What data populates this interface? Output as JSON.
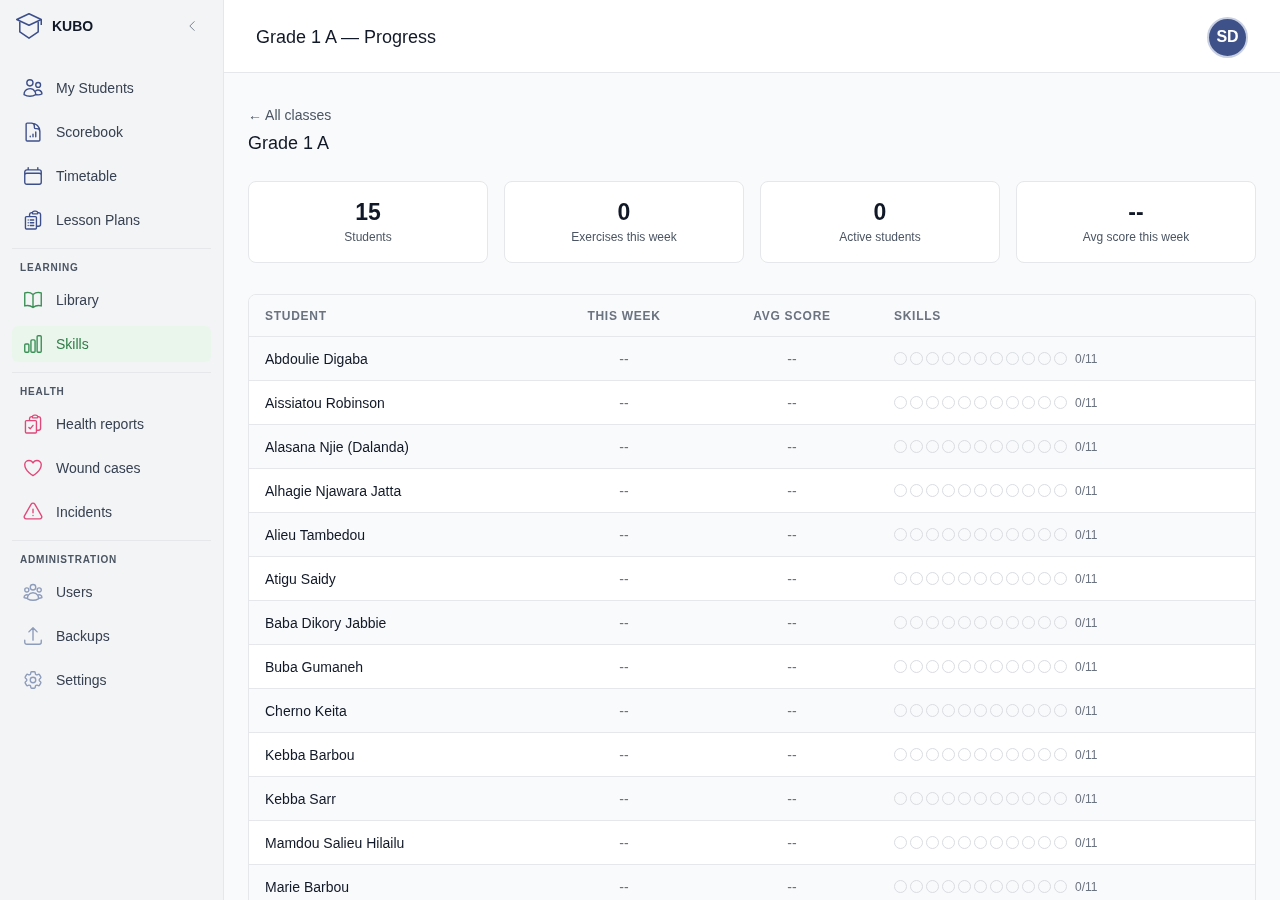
{
  "sidebar": {
    "brand": "KUBO",
    "sections": [
      {
        "items": [
          {
            "label": "My Students",
            "selected": false
          },
          {
            "label": "Scorebook",
            "selected": false
          },
          {
            "label": "Timetable",
            "selected": false
          },
          {
            "label": "Lesson Plans",
            "selected": false
          }
        ]
      },
      {
        "title": "LEARNING",
        "items": [
          {
            "label": "Library",
            "selected": false
          },
          {
            "label": "Skills",
            "selected": true
          }
        ]
      },
      {
        "title": "HEALTH",
        "items": [
          {
            "label": "Health reports",
            "selected": false
          },
          {
            "label": "Wound cases",
            "selected": false
          },
          {
            "label": "Incidents",
            "selected": false
          }
        ]
      },
      {
        "title": "ADMINISTRATION",
        "items": [
          {
            "label": "Users",
            "selected": false
          },
          {
            "label": "Backups",
            "selected": false
          },
          {
            "label": "Settings",
            "selected": false
          }
        ]
      }
    ]
  },
  "header": {
    "title": "Grade 1 A — Progress",
    "avatar": "SD"
  },
  "back_link": "← All classes",
  "page_title": "Grade 1 A",
  "stats": [
    {
      "value": "15",
      "label": "Students"
    },
    {
      "value": "0",
      "label": "Exercises this week"
    },
    {
      "value": "0",
      "label": "Active students"
    },
    {
      "value": "--",
      "label": "Avg score this week"
    }
  ],
  "table": {
    "columns": [
      "STUDENT",
      "THIS WEEK",
      "AVG SCORE",
      "SKILLS"
    ],
    "rows": [
      {
        "student": "Abdoulie Digaba",
        "this_week": "--",
        "avg_score": "--",
        "skills": [
          {
            "achieved": false
          },
          {
            "achieved": false
          },
          {
            "achieved": false
          },
          {
            "achieved": false
          },
          {
            "achieved": false
          },
          {
            "achieved": false
          },
          {
            "achieved": false
          },
          {
            "achieved": false
          },
          {
            "achieved": false
          },
          {
            "achieved": false
          },
          {
            "achieved": false
          }
        ],
        "skills_count": "0/11"
      },
      {
        "student": "Aissiatou Robinson",
        "this_week": "--",
        "avg_score": "--",
        "skills": [
          {
            "achieved": false
          },
          {
            "achieved": false
          },
          {
            "achieved": false
          },
          {
            "achieved": false
          },
          {
            "achieved": false
          },
          {
            "achieved": false
          },
          {
            "achieved": false
          },
          {
            "achieved": false
          },
          {
            "achieved": false
          },
          {
            "achieved": false
          },
          {
            "achieved": false
          }
        ],
        "skills_count": "0/11"
      },
      {
        "student": "Alasana Njie (Dalanda)",
        "this_week": "--",
        "avg_score": "--",
        "skills": [
          {
            "achieved": false
          },
          {
            "achieved": false
          },
          {
            "achieved": false
          },
          {
            "achieved": false
          },
          {
            "achieved": false
          },
          {
            "achieved": false
          },
          {
            "achieved": false
          },
          {
            "achieved": false
          },
          {
            "achieved": false
          },
          {
            "achieved": false
          },
          {
            "achieved": false
          }
        ],
        "skills_count": "0/11"
      },
      {
        "student": "Alhagie Njawara Jatta",
        "this_week": "--",
        "avg_score": "--",
        "skills": [
          {
            "achieved": false
          },
          {
            "achieved": false
          },
          {
            "achieved": false
          },
          {
            "achieved": false
          },
          {
            "achieved": false
          },
          {
            "achieved": false
          },
          {
            "achieved": false
          },
          {
            "achieved": false
          },
          {
            "achieved": false
          },
          {
            "achieved": false
          },
          {
            "achieved": false
          }
        ],
        "skills_count": "0/11"
      },
      {
        "student": "Alieu Tambedou",
        "this_week": "--",
        "avg_score": "--",
        "skills": [
          {
            "achieved": false
          },
          {
            "achieved": false
          },
          {
            "achieved": false
          },
          {
            "achieved": false
          },
          {
            "achieved": false
          },
          {
            "achieved": false
          },
          {
            "achieved": false
          },
          {
            "achieved": false
          },
          {
            "achieved": false
          },
          {
            "achieved": false
          },
          {
            "achieved": false
          }
        ],
        "skills_count": "0/11"
      },
      {
        "student": "Atigu Saidy",
        "this_week": "--",
        "avg_score": "--",
        "skills": [
          {
            "achieved": false
          },
          {
            "achieved": false
          },
          {
            "achieved": false
          },
          {
            "achieved": false
          },
          {
            "achieved": false
          },
          {
            "achieved": false
          },
          {
            "achieved": false
          },
          {
            "achieved": false
          },
          {
            "achieved": false
          },
          {
            "achieved": false
          },
          {
            "achieved": false
          }
        ],
        "skills_count": "0/11"
      },
      {
        "student": "Baba Dikory Jabbie",
        "this_week": "--",
        "avg_score": "--",
        "skills": [
          {
            "achieved": false
          },
          {
            "achieved": false
          },
          {
            "achieved": false
          },
          {
            "achieved": false
          },
          {
            "achieved": false
          },
          {
            "achieved": false
          },
          {
            "achieved": false
          },
          {
            "achieved": false
          },
          {
            "achieved": false
          },
          {
            "achieved": false
          },
          {
            "achieved": false
          }
        ],
        "skills_count": "0/11"
      },
      {
        "student": "Buba Gumaneh",
        "this_week": "--",
        "avg_score": "--",
        "skills": [
          {
            "achieved": false
          },
          {
            "achieved": false
          },
          {
            "achieved": false
          },
          {
            "achieved": false
          },
          {
            "achieved": false
          },
          {
            "achieved": false
          },
          {
            "achieved": false
          },
          {
            "achieved": false
          },
          {
            "achieved": false
          },
          {
            "achieved": false
          },
          {
            "achieved": false
          }
        ],
        "skills_count": "0/11"
      },
      {
        "student": "Cherno Keita",
        "this_week": "--",
        "avg_score": "--",
        "skills": [
          {
            "achieved": false
          },
          {
            "achieved": false
          },
          {
            "achieved": false
          },
          {
            "achieved": false
          },
          {
            "achieved": false
          },
          {
            "achieved": false
          },
          {
            "achieved": false
          },
          {
            "achieved": false
          },
          {
            "achieved": false
          },
          {
            "achieved": false
          },
          {
            "achieved": false
          }
        ],
        "skills_count": "0/11"
      },
      {
        "student": "Kebba Barbou",
        "this_week": "--",
        "avg_score": "--",
        "skills": [
          {
            "achieved": false
          },
          {
            "achieved": false
          },
          {
            "achieved": false
          },
          {
            "achieved": false
          },
          {
            "achieved": false
          },
          {
            "achieved": false
          },
          {
            "achieved": false
          },
          {
            "achieved": false
          },
          {
            "achieved": false
          },
          {
            "achieved": false
          },
          {
            "achieved": false
          }
        ],
        "skills_count": "0/11"
      },
      {
        "student": "Kebba Sarr",
        "this_week": "--",
        "avg_score": "--",
        "skills": [
          {
            "achieved": false
          },
          {
            "achieved": false
          },
          {
            "achieved": false
          },
          {
            "achieved": false
          },
          {
            "achieved": false
          },
          {
            "achieved": false
          },
          {
            "achieved": false
          },
          {
            "achieved": false
          },
          {
            "achieved": false
          },
          {
            "achieved": false
          },
          {
            "achieved": false
          }
        ],
        "skills_count": "0/11"
      },
      {
        "student": "Mamdou Salieu Hilailu",
        "this_week": "--",
        "avg_score": "--",
        "skills": [
          {
            "achieved": false
          },
          {
            "achieved": false
          },
          {
            "achieved": false
          },
          {
            "achieved": false
          },
          {
            "achieved": false
          },
          {
            "achieved": false
          },
          {
            "achieved": false
          },
          {
            "achieved": false
          },
          {
            "achieved": false
          },
          {
            "achieved": false
          },
          {
            "achieved": false
          }
        ],
        "skills_count": "0/11"
      },
      {
        "student": "Marie Barbou",
        "this_week": "--",
        "avg_score": "--",
        "skills": [
          {
            "achieved": false
          },
          {
            "achieved": false
          },
          {
            "achieved": false
          },
          {
            "achieved": false
          },
          {
            "achieved": false
          },
          {
            "achieved": false
          },
          {
            "achieved": false
          },
          {
            "achieved": false
          },
          {
            "achieved": false
          },
          {
            "achieved": false
          },
          {
            "achieved": false
          }
        ],
        "skills_count": "0/11"
      }
    ]
  }
}
